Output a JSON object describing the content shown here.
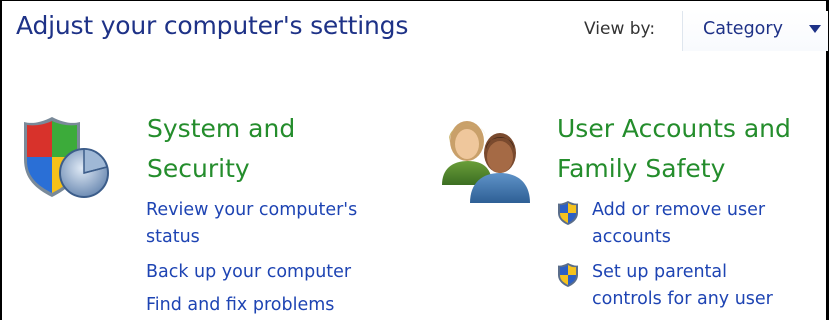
{
  "header": {
    "title": "Adjust your computer's settings",
    "view_by_label": "View by:",
    "view_by_value": "Category"
  },
  "categories": [
    {
      "title_line1": "System and",
      "title_line2": "Security",
      "icon": "shield-pie-icon",
      "links": [
        {
          "line1": "Review your computer's",
          "line2": "status"
        },
        {
          "line1": "Back up your computer"
        },
        {
          "line1": "Find and fix problems"
        }
      ]
    },
    {
      "title_line1": "User Accounts and",
      "title_line2": "Family Safety",
      "icon": "users-icon",
      "links": [
        {
          "line1": "Add or remove user",
          "line2": "accounts",
          "icon": "uac-shield-icon"
        },
        {
          "line1": "Set up parental",
          "line2": "controls for any user",
          "icon": "uac-shield-icon"
        }
      ]
    }
  ],
  "colors": {
    "title": "#1e3287",
    "category": "#248d2c",
    "link": "#1e44b3"
  }
}
